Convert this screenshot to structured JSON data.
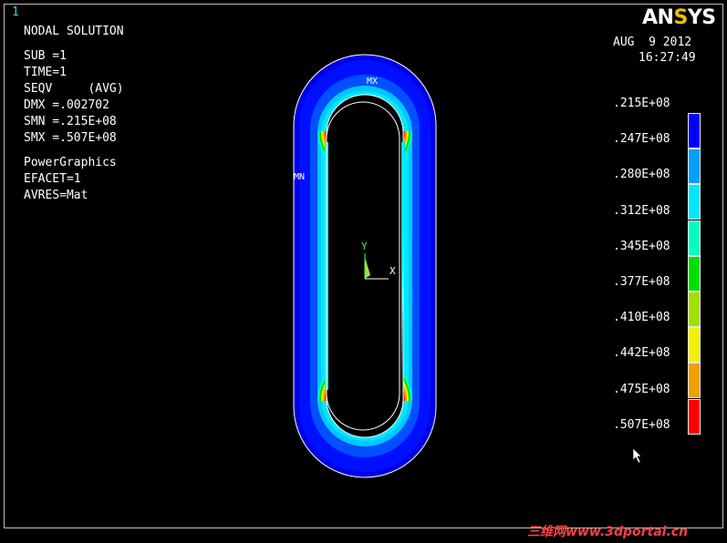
{
  "window": {
    "number": "1"
  },
  "logo": {
    "text_main": "AN",
    "text_accent": "S",
    "text_end": "YS"
  },
  "timestamp": {
    "date": "AUG  9 2012",
    "time": "16:27:49"
  },
  "info": {
    "title": "NODAL SOLUTION",
    "sub": "SUB =1",
    "time": "TIME=1",
    "seqv": "SEQV     (AVG)",
    "dmx": "DMX =.002702",
    "smn": "SMN =.215E+08",
    "smx": "SMX =.507E+08",
    "graphics": "PowerGraphics",
    "efacet": "EFACET=1",
    "avres": "AVRES=Mat"
  },
  "legend": {
    "labels": [
      ".215E+08",
      ".247E+08",
      ".280E+08",
      ".312E+08",
      ".345E+08",
      ".377E+08",
      ".410E+08",
      ".442E+08",
      ".475E+08",
      ".507E+08"
    ],
    "colors": [
      "#0000ff",
      "#00a0ff",
      "#00e8ff",
      "#00ffc0",
      "#00e000",
      "#a0e000",
      "#f0f000",
      "#f0a000",
      "#ff0000"
    ]
  },
  "plot": {
    "max_label": "MX",
    "min_label": "MN",
    "axis_y": "Y",
    "axis_x": "X",
    "colors": {
      "outer": "#0000e8",
      "blue2": "#0050ff",
      "cyan": "#00c8ff",
      "cyan2": "#00e8ff",
      "teal": "#00ffc0",
      "green": "#00e000",
      "yellow": "#f0f000",
      "orange": "#f0a000",
      "red": "#ff2000"
    }
  },
  "watermark": {
    "text": "三维网www.3dportal.cn"
  }
}
